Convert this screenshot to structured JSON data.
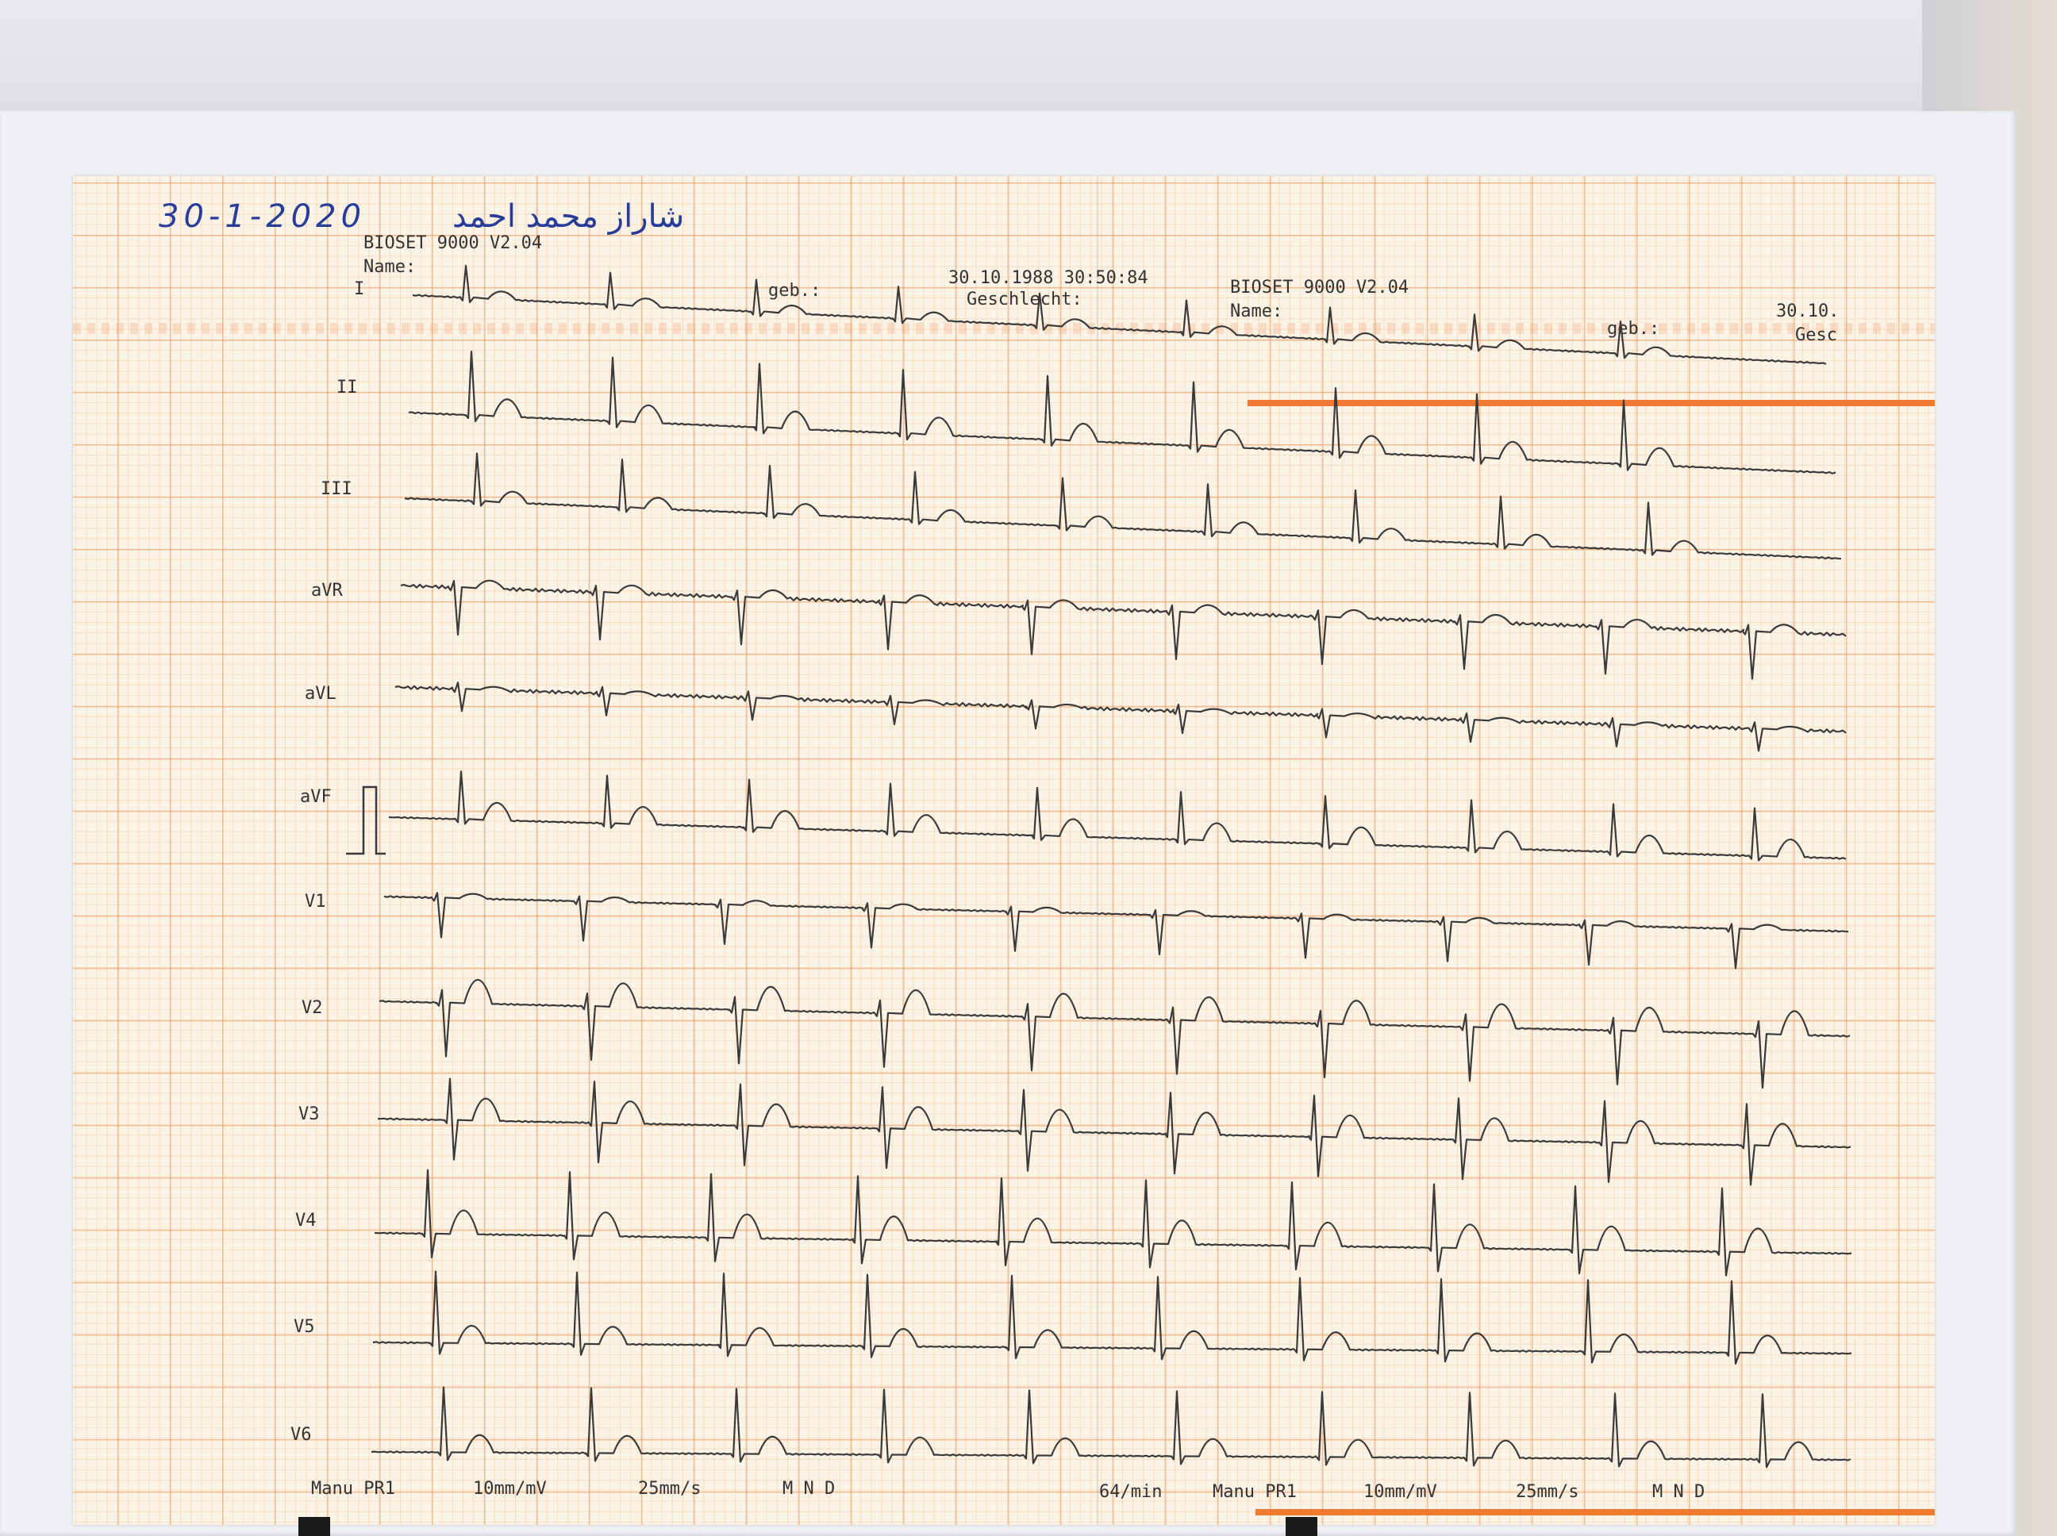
{
  "handwriting": {
    "date": "30-1-2020",
    "name": "شاراز محمد احمد"
  },
  "header_left": {
    "device": "BIOSET 9000 V2.04",
    "name_label": "Name:",
    "dob_label": "geb.:",
    "datetime": "30.10.1988 30:50:84",
    "sex_label": "Geschlecht:"
  },
  "header_right": {
    "device": "BIOSET 9000 V2.04",
    "name_label": "Name:",
    "dob_label": "geb.:",
    "date_partial": "30.10.",
    "sex_partial": "Gesc"
  },
  "leads": [
    "I",
    "II",
    "III",
    "aVR",
    "aVL",
    "aVF",
    "V1",
    "V2",
    "V3",
    "V4",
    "V5",
    "V6"
  ],
  "footer_left": {
    "mode": "Manu PR1",
    "gain": "10mm/mV",
    "speed": "25mm/s",
    "filters": "M N D"
  },
  "footer_right": {
    "rate": "64/min",
    "mode": "Manu PR1",
    "gain": "10mm/mV",
    "speed": "25mm/s",
    "filters": "M N D"
  },
  "colors": {
    "grid": "#e8965a",
    "paper": "#fbf3e6",
    "trace": "#3a3a3a",
    "ink": "#283c9a",
    "stripe": "#f07a32"
  }
}
